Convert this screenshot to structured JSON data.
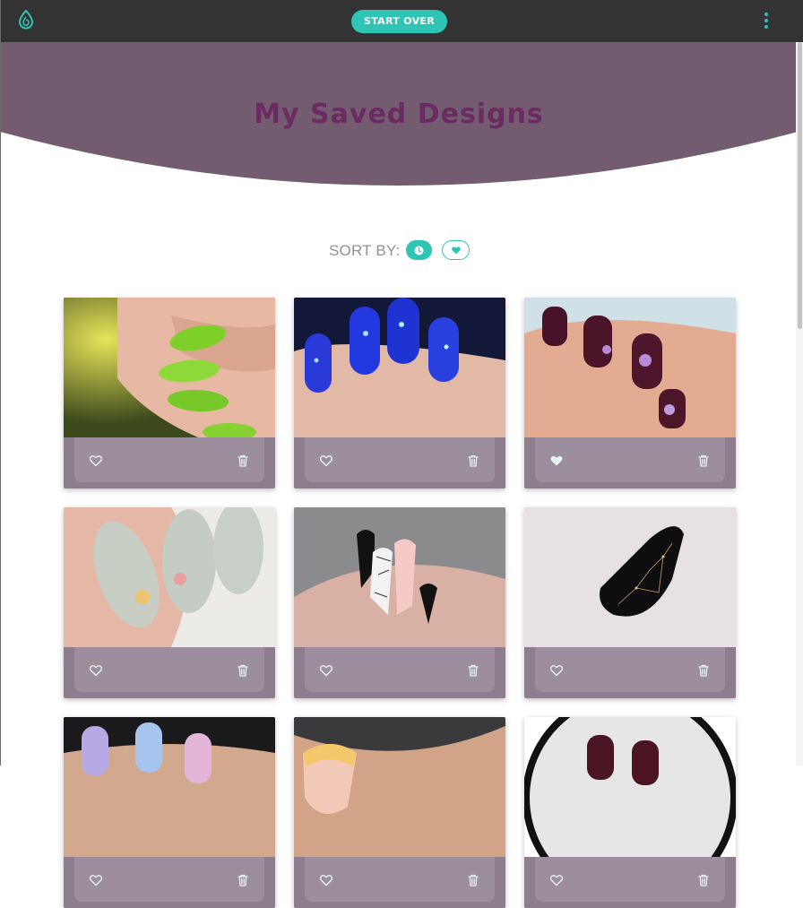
{
  "topbar": {
    "start_over_label": "START OVER",
    "logo_icon": "drop-logo-icon",
    "menu_icon": "kebab-menu-icon"
  },
  "page": {
    "title": "My Saved Designs"
  },
  "sort": {
    "label": "SORT BY:",
    "options": [
      {
        "name": "recent",
        "icon": "clock-icon",
        "active": true
      },
      {
        "name": "favorites",
        "icon": "heart-icon",
        "active": false
      }
    ]
  },
  "designs": [
    {
      "description": "green glitter nails",
      "favorited": false
    },
    {
      "description": "blue glitter nails",
      "favorited": false
    },
    {
      "description": "plum nails with flowers",
      "favorited": true
    },
    {
      "description": "sage nails with flowers",
      "favorited": false
    },
    {
      "description": "black white pink web nails",
      "favorited": false
    },
    {
      "description": "black constellation nail",
      "favorited": false
    },
    {
      "description": "pastel swirl nails",
      "favorited": false
    },
    {
      "description": "french tip nails",
      "favorited": false
    },
    {
      "description": "plum nails",
      "favorited": false
    }
  ],
  "colors": {
    "topbar": "#333333",
    "accent": "#2ec4b6",
    "hero": "#735c70",
    "title": "#6b2a62",
    "card": "#8e7d8d",
    "card_bar": "#9c8e9c"
  }
}
